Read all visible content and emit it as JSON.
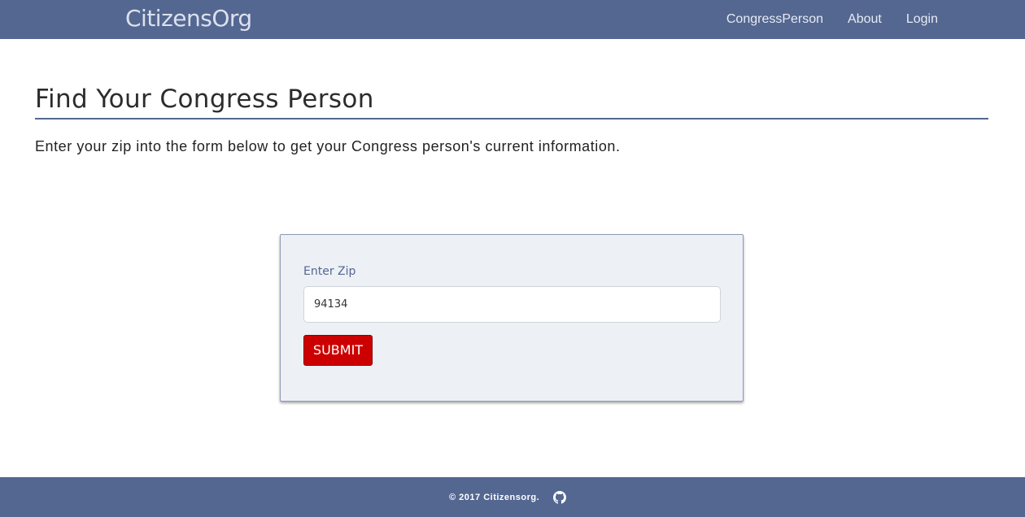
{
  "navbar": {
    "brand": "CitizensOrg",
    "links": [
      {
        "label": "CongressPerson"
      },
      {
        "label": "About"
      },
      {
        "label": "Login"
      }
    ]
  },
  "main": {
    "title": "Find Your Congress Person",
    "intro": "Enter your zip into the form below to get your Congress person's current information."
  },
  "form": {
    "zip_label": "Enter Zip",
    "zip_value": "94134",
    "submit_label": "SUBMIT"
  },
  "footer": {
    "copyright": "© 2017 Citizensorg.",
    "github_icon": "github-icon"
  },
  "colors": {
    "navbar_bg": "#546791",
    "accent": "#546791",
    "submit_bg": "#cc0000",
    "card_bg": "#edf1f5"
  }
}
